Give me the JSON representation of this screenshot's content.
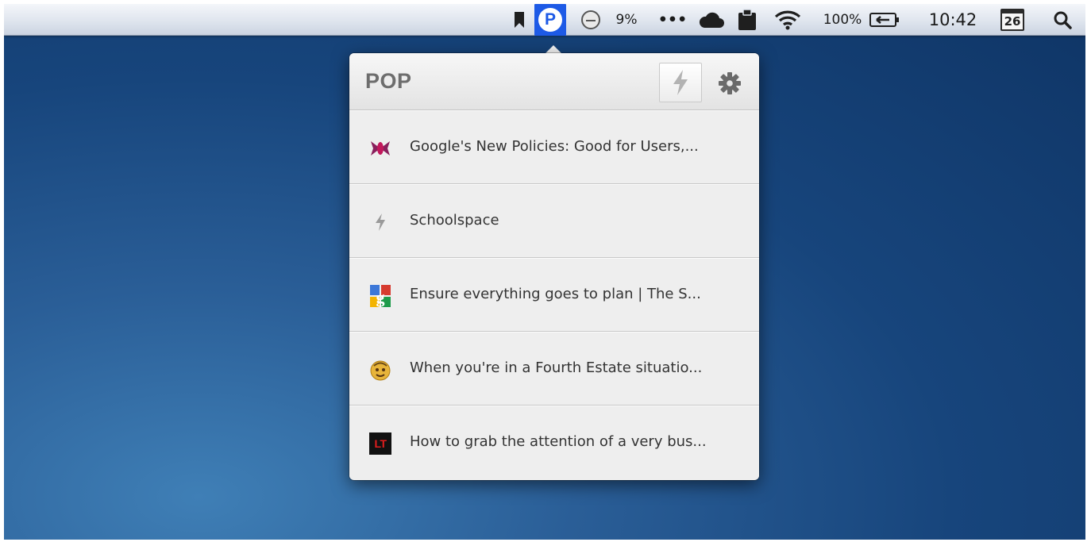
{
  "menubar": {
    "status_percent": "9%",
    "dots": "•••",
    "battery_percent": "100%",
    "clock": "10:42",
    "calendar_day": "26",
    "pop_letter": "P"
  },
  "popover": {
    "title": "POP",
    "items": [
      {
        "label": "Google's New Policies: Good for Users,...",
        "icon": "butterfly-icon"
      },
      {
        "label": "Schoolspace",
        "icon": "bolt-icon"
      },
      {
        "label": "Ensure everything goes to plan | The S...",
        "icon": "google-apps-icon"
      },
      {
        "label": "When you're in a Fourth Estate situatio...",
        "icon": "smiley-icon"
      },
      {
        "label": "How to grab the attention of a very bus...",
        "icon": "lt-icon",
        "icon_text": "LT"
      }
    ]
  },
  "colors": {
    "desktop": "#17457c",
    "accent": "#1d5ae6",
    "popover_bg": "#ededed"
  }
}
